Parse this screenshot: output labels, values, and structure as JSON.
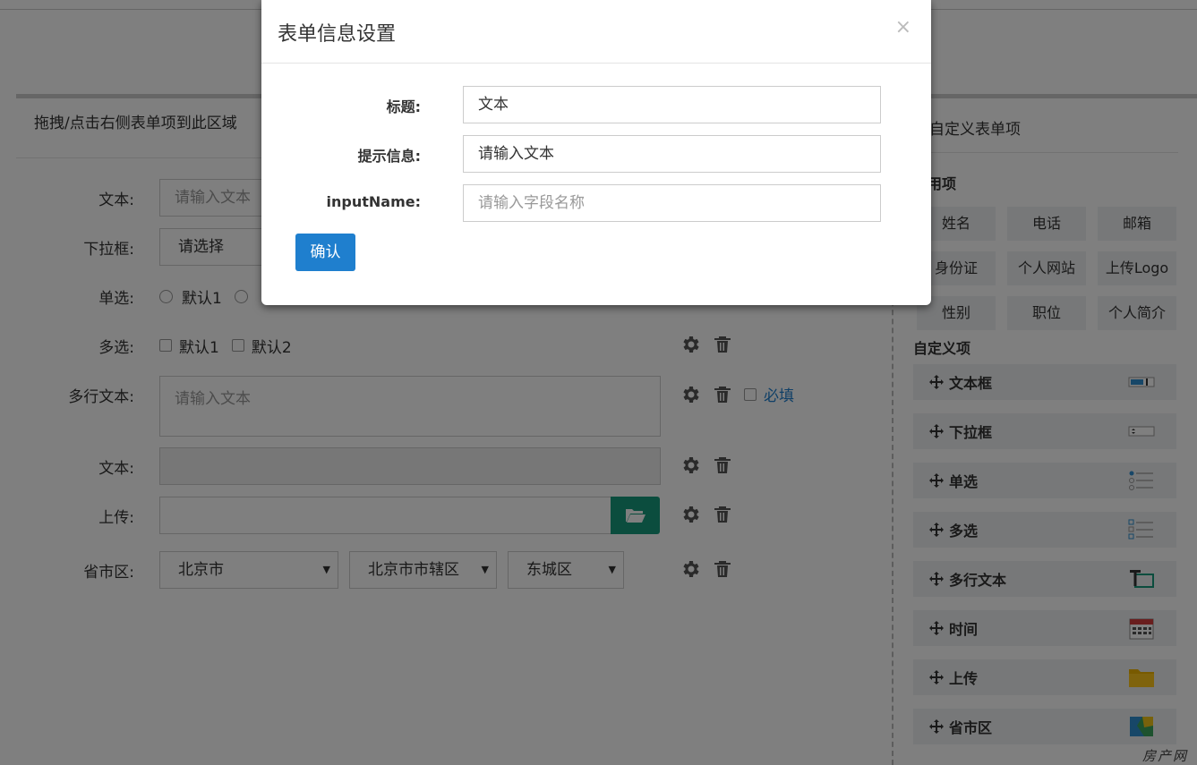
{
  "left": {
    "header": "拖拽/点击右侧表单项到此区域",
    "rows": {
      "text1": {
        "label": "文本:",
        "placeholder": "请输入文本"
      },
      "dropdown": {
        "label": "下拉框:",
        "value": "请选择"
      },
      "radio": {
        "label": "单选:",
        "options": [
          "默认1"
        ]
      },
      "checkbox": {
        "label": "多选:",
        "options": [
          "默认1",
          "默认2"
        ]
      },
      "textarea": {
        "label": "多行文本:",
        "placeholder": "请输入文本",
        "required_label": "必填"
      },
      "text2": {
        "label": "文本:"
      },
      "upload": {
        "label": "上传:"
      },
      "region": {
        "label": "省市区:",
        "province": "北京市",
        "city": "北京市市辖区",
        "district": "东城区"
      }
    }
  },
  "right": {
    "header": "自定义表单项",
    "common_title": "常用项",
    "common_items": [
      "姓名",
      "电话",
      "邮箱",
      "身份证",
      "个人网站",
      "上传Logo",
      "性别",
      "职位",
      "个人简介"
    ],
    "custom_title": "自定义项",
    "custom_items": [
      "文本框",
      "下拉框",
      "单选",
      "多选",
      "多行文本",
      "时间",
      "上传",
      "省市区"
    ]
  },
  "modal": {
    "title": "表单信息设置",
    "close": "×",
    "fields": {
      "title": {
        "label": "标题:",
        "value": "文本"
      },
      "hint": {
        "label": "提示信息:",
        "value": "请输入文本"
      },
      "input_name": {
        "label": "inputName:",
        "placeholder": "请输入字段名称"
      }
    },
    "confirm_label": "确认"
  },
  "watermark": "房产网",
  "colors": {
    "primary": "#1f7fce",
    "upload": "#169a7c",
    "overlay": "rgba(0,0,0,0.5)"
  }
}
